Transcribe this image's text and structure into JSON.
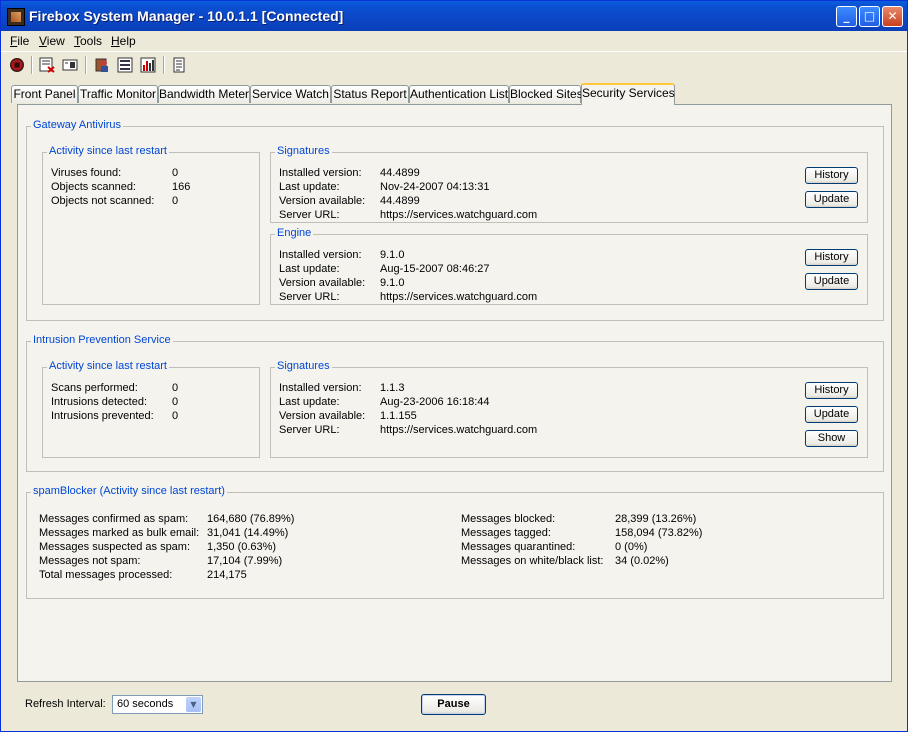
{
  "window": {
    "title": "Firebox System Manager - 10.0.1.1 [Connected]"
  },
  "menu": [
    "File",
    "View",
    "Tools",
    "Help"
  ],
  "toolbar": {
    "icons": [
      "stop-icon",
      "report-icon",
      "display-icon",
      "user-icon",
      "list-icon",
      "chart-icon",
      "document-icon"
    ]
  },
  "tabs": [
    "Front Panel",
    "Traffic Monitor",
    "Bandwidth Meter",
    "Service Watch",
    "Status Report",
    "Authentication List",
    "Blocked Sites",
    "Security Services"
  ],
  "active_tab": "Security Services",
  "gav": {
    "title": "Gateway Antivirus",
    "activity": {
      "title": "Activity since last restart",
      "rows": [
        {
          "label": "Viruses found:",
          "value": "0"
        },
        {
          "label": "Objects scanned:",
          "value": "166"
        },
        {
          "label": "Objects not scanned:",
          "value": "0"
        }
      ]
    },
    "signatures": {
      "title": "Signatures",
      "rows": [
        {
          "label": "Installed version:",
          "value": "44.4899"
        },
        {
          "label": "Last update:",
          "value": "Nov-24-2007 04:13:31"
        },
        {
          "label": "Version available:",
          "value": "44.4899"
        },
        {
          "label": "Server URL:",
          "value": "https://services.watchguard.com"
        }
      ],
      "history": "History",
      "update": "Update"
    },
    "engine": {
      "title": "Engine",
      "rows": [
        {
          "label": "Installed version:",
          "value": "9.1.0"
        },
        {
          "label": "Last update:",
          "value": "Aug-15-2007 08:46:27"
        },
        {
          "label": "Version available:",
          "value": "9.1.0"
        },
        {
          "label": "Server URL:",
          "value": "https://services.watchguard.com"
        }
      ],
      "history": "History",
      "update": "Update"
    }
  },
  "ips": {
    "title": "Intrusion Prevention Service",
    "activity": {
      "title": "Activity since last restart",
      "rows": [
        {
          "label": "Scans performed:",
          "value": "0"
        },
        {
          "label": "Intrusions detected:",
          "value": "0"
        },
        {
          "label": "Intrusions prevented:",
          "value": "0"
        }
      ]
    },
    "signatures": {
      "title": "Signatures",
      "rows": [
        {
          "label": "Installed version:",
          "value": "1.1.3"
        },
        {
          "label": "Last update:",
          "value": "Aug-23-2006 16:18:44"
        },
        {
          "label": "Version available:",
          "value": "1.1.155"
        },
        {
          "label": "Server URL:",
          "value": "https://services.watchguard.com"
        }
      ],
      "history": "History",
      "update": "Update",
      "show": "Show"
    }
  },
  "spam": {
    "title": "spamBlocker (Activity since last restart)",
    "left": [
      {
        "label": "Messages confirmed as spam:",
        "value": "164,680 (76.89%)"
      },
      {
        "label": "Messages marked as bulk email:",
        "value": "31,041 (14.49%)"
      },
      {
        "label": "Messages suspected as spam:",
        "value": "1,350 (0.63%)"
      },
      {
        "label": "Messages not spam:",
        "value": "17,104 (7.99%)"
      },
      {
        "label": "Total messages processed:",
        "value": "214,175"
      }
    ],
    "right": [
      {
        "label": "Messages blocked:",
        "value": "28,399 (13.26%)"
      },
      {
        "label": "Messages tagged:",
        "value": "158,094 (73.82%)"
      },
      {
        "label": "Messages quarantined:",
        "value": "0 (0%)"
      },
      {
        "label": "Messages on white/black list:",
        "value": "34 (0.02%)"
      }
    ]
  },
  "bottom": {
    "refresh_label": "Refresh Interval:",
    "refresh_value": "60 seconds",
    "pause": "Pause"
  }
}
